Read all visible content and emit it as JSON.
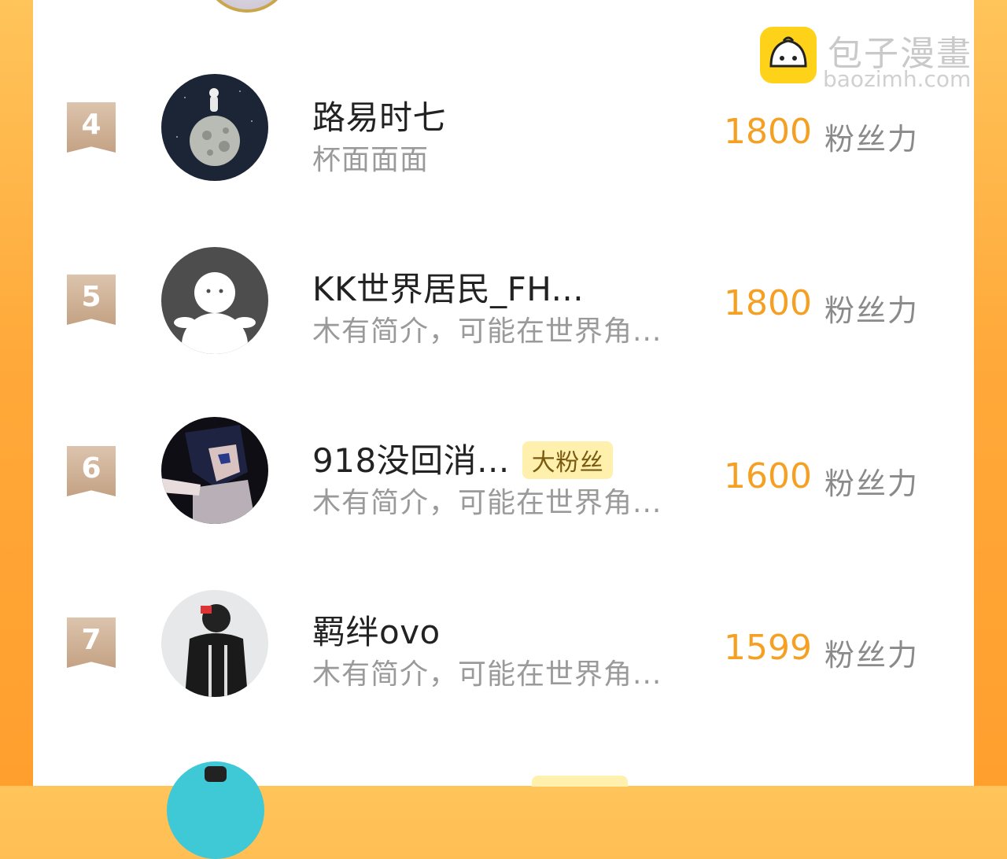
{
  "watermark": {
    "title": "包子漫畫",
    "url": "baozimh.com"
  },
  "ranking": [
    {
      "rank": "4",
      "name": "路易时七",
      "bio": "杯面面面",
      "badge": "",
      "score": "1800",
      "unit": "粉丝力"
    },
    {
      "rank": "5",
      "name": "KK世界居民_FH...",
      "bio": "木有简介，可能在世界角...",
      "badge": "",
      "score": "1800",
      "unit": "粉丝力"
    },
    {
      "rank": "6",
      "name": "918没回消...",
      "bio": "木有简介，可能在世界角...",
      "badge": "大粉丝",
      "score": "1600",
      "unit": "粉丝力"
    },
    {
      "rank": "7",
      "name": "羁绊ovo",
      "bio": "木有简介，可能在世界角...",
      "badge": "",
      "score": "1599",
      "unit": "粉丝力"
    }
  ],
  "colors": {
    "accent": "#f5a022",
    "frame": "#ffa93a",
    "rank_badge": "#c4a284",
    "fan_badge_bg": "#fff0ad"
  }
}
